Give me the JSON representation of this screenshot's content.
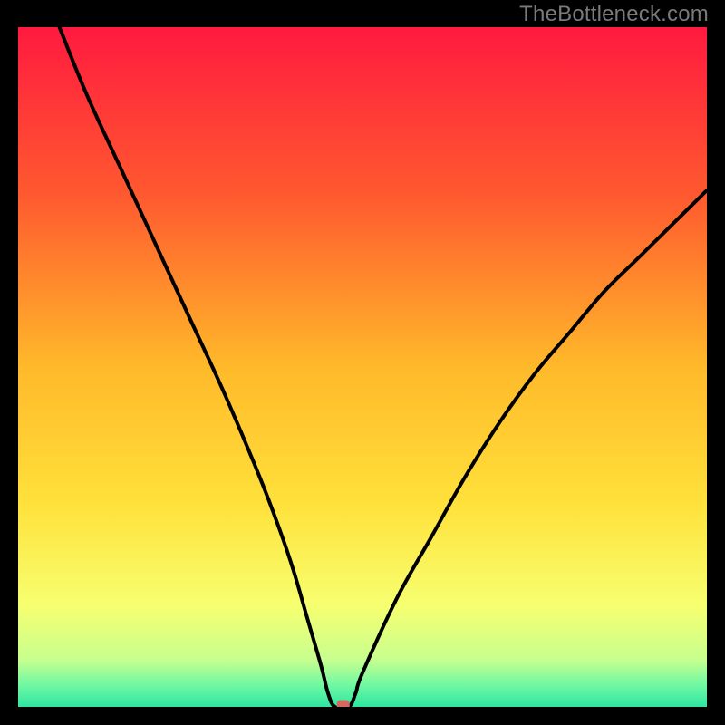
{
  "watermark": "TheBottleneck.com",
  "chart_data": {
    "type": "line",
    "title": "",
    "xlabel": "",
    "ylabel": "",
    "xlim": [
      0,
      100
    ],
    "ylim": [
      0,
      100
    ],
    "grid": false,
    "legend": false,
    "x": [
      6,
      10,
      15,
      20,
      25,
      30,
      35,
      38,
      40,
      42,
      44,
      45,
      46,
      48,
      49,
      50,
      55,
      60,
      65,
      70,
      75,
      80,
      85,
      90,
      95,
      100
    ],
    "values": [
      100,
      90,
      79,
      68,
      57,
      46,
      34,
      26,
      20,
      13,
      6,
      2,
      0,
      0,
      2,
      5,
      16,
      25,
      34,
      42,
      49,
      55,
      61,
      66,
      71,
      76
    ],
    "marker": {
      "x": 47.2,
      "y": 0.2,
      "color": "#d46a5f"
    },
    "gradient_stops": [
      {
        "offset": 0.0,
        "color": "#ff1a3f"
      },
      {
        "offset": 0.25,
        "color": "#ff5a2f"
      },
      {
        "offset": 0.5,
        "color": "#ffb92a"
      },
      {
        "offset": 0.7,
        "color": "#ffe13a"
      },
      {
        "offset": 0.85,
        "color": "#f7ff70"
      },
      {
        "offset": 0.93,
        "color": "#c8ff8e"
      },
      {
        "offset": 0.97,
        "color": "#6cf7a3"
      },
      {
        "offset": 1.0,
        "color": "#2ee6a0"
      }
    ]
  }
}
